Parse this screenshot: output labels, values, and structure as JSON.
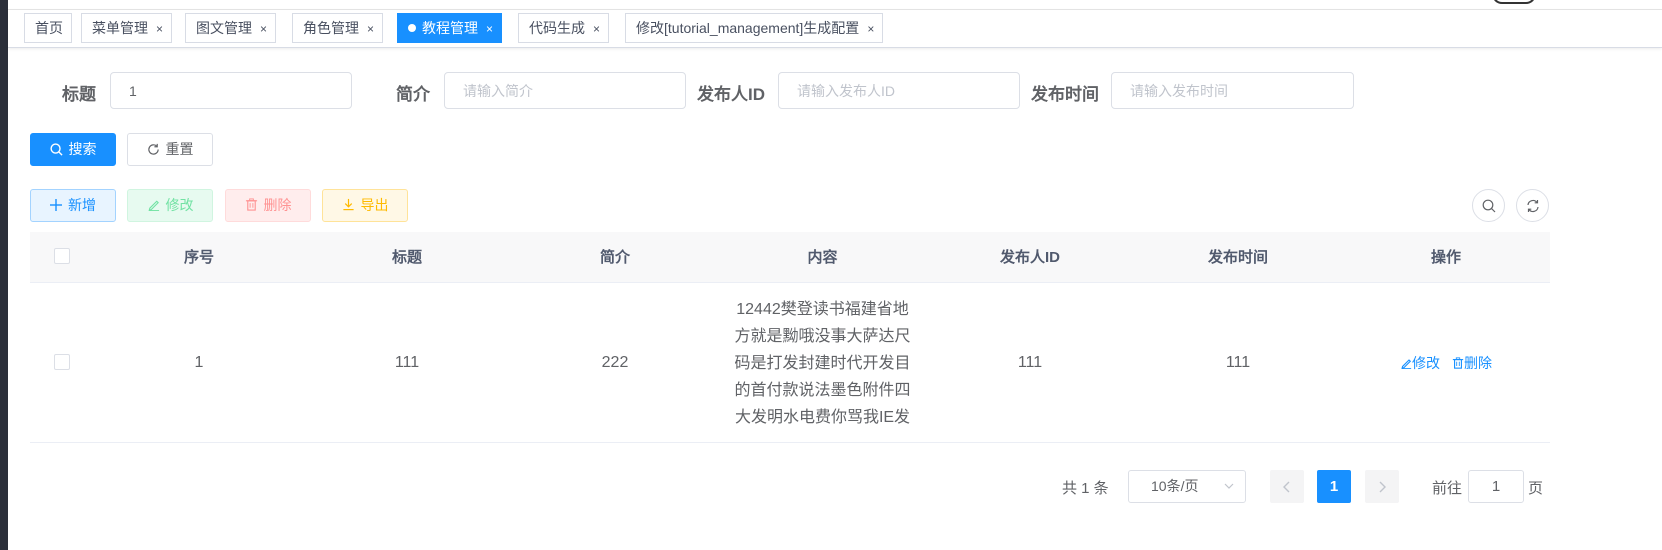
{
  "tags": [
    {
      "label": "首页",
      "closable": false,
      "active": false
    },
    {
      "label": "菜单管理",
      "closable": true,
      "active": false
    },
    {
      "label": "图文管理",
      "closable": true,
      "active": false
    },
    {
      "label": "角色管理",
      "closable": true,
      "active": false
    },
    {
      "label": "教程管理",
      "closable": true,
      "active": true
    },
    {
      "label": "代码生成",
      "closable": true,
      "active": false
    },
    {
      "label": "修改[tutorial_management]生成配置",
      "closable": true,
      "active": false
    }
  ],
  "tag_close_glyph": "×",
  "search_form": {
    "title_label": "标题",
    "title_value": "1",
    "intro_label": "简介",
    "intro_placeholder": "请输入简介",
    "publisher_label": "发布人ID",
    "publisher_placeholder": "请输入发布人ID",
    "time_label": "发布时间",
    "time_placeholder": "请输入发布时间",
    "search_button": "搜索",
    "reset_button": "重置"
  },
  "toolbar": {
    "add": "新增",
    "edit": "修改",
    "delete": "删除",
    "export": "导出"
  },
  "table": {
    "columns": [
      "序号",
      "标题",
      "简介",
      "内容",
      "发布人ID",
      "发布时间",
      "操作"
    ],
    "rows": [
      {
        "index": "1",
        "title": "111",
        "intro": "222",
        "content": "12442樊登读书福建省地方就是黝哦没事大萨达尺码是打发封建时代开发目的首付款说法墨色附件四大发明水电费你骂我IE发",
        "publisher_id": "111",
        "publish_time": "111",
        "edit_label": "修改",
        "delete_label": "删除"
      }
    ]
  },
  "pagination": {
    "total": "共 1 条",
    "page_size": "10条/页",
    "current_page": "1",
    "goto_prefix": "前往",
    "goto_value": "1",
    "goto_suffix": "页"
  },
  "colors": {
    "primary": "#1890ff",
    "success": "#71e2a3",
    "danger": "#ff9292",
    "warning": "#ffba00"
  }
}
